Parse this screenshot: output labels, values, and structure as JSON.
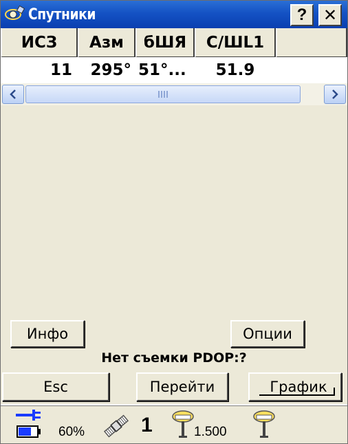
{
  "window": {
    "title": "Спутники",
    "help_label": "?",
    "close_label": "✕"
  },
  "table": {
    "columns": [
      "ИСЗ",
      "Азм",
      "бШЯ",
      "С/ШL1",
      ""
    ],
    "rows": [
      [
        "11",
        "295°",
        "51°...",
        "51.9",
        ""
      ]
    ]
  },
  "buttons": {
    "info": "Инфо",
    "options": "Опции",
    "esc": "Esc",
    "goto": "Перейти",
    "graph": "График"
  },
  "status": {
    "message": "Нет съемки  PDOP:?"
  },
  "statusbar": {
    "battery_percent": "60%",
    "satellites_count": "1",
    "antenna_height": "1.500"
  },
  "colors": {
    "titlebar": "#1452c4",
    "background": "#ece9d8",
    "accent_blue": "#1a3cff"
  }
}
